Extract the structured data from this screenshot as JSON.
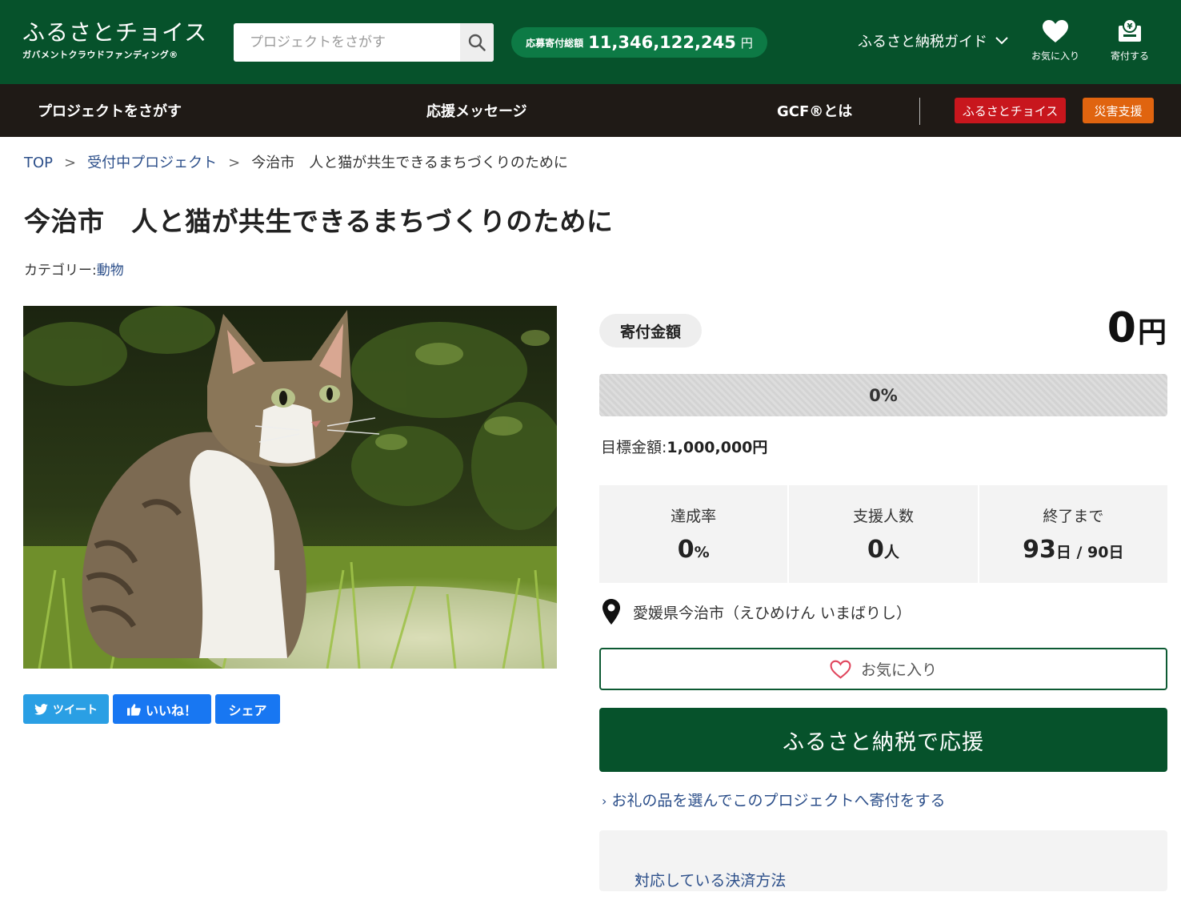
{
  "header": {
    "logo_main": "ふるさとチョイス",
    "logo_sub": "ガバメントクラウドファンディング®",
    "search_placeholder": "プロジェクトをさがす",
    "total_label": "応募寄付総額",
    "total_value": "11,346,122,245",
    "total_unit": "円",
    "guide_label": "ふるさと納税ガイド",
    "favorites_label": "お気に入り",
    "donate_label": "寄付する",
    "colors": {
      "header_bg": "#06522b",
      "pill_bg": "#0d7a45"
    }
  },
  "nav": {
    "items": [
      "プロジェクトをさがす",
      "応援メッセージ",
      "GCF®とは"
    ],
    "tag_choice": "ふるさとチョイス",
    "tag_disaster": "災害支援",
    "colors": {
      "nav_bg": "#1f1a16",
      "choice_tag": "#c8161d",
      "disaster_tag": "#e0640f"
    }
  },
  "breadcrumb": {
    "top": "TOP",
    "projects": "受付中プロジェクト",
    "current": "今治市　人と猫が共生できるまちづくりのために",
    "separator": ">"
  },
  "page": {
    "title": "今治市　人と猫が共生できるまちづくりのために",
    "category_label": "カテゴリー:",
    "category_value": "動物"
  },
  "social": {
    "tweet": "ツイート",
    "like": "いいね！",
    "share": "シェア"
  },
  "donation": {
    "amount_label": "寄付金額",
    "amount_value": "0",
    "amount_unit": "円",
    "progress_fraction": 0,
    "progress_text": "0%",
    "goal_label": "目標金額:",
    "goal_value": "1,000,000円",
    "stats": {
      "rate_label": "達成率",
      "rate_value": "0",
      "rate_unit": "%",
      "supporters_label": "支援人数",
      "supporters_value": "0",
      "supporters_unit": "人",
      "remaining_label": "終了まで",
      "remaining_value": "93",
      "remaining_unit": "日 / 90日"
    },
    "location": "愛媛県今治市（えひめけん いまばりし）",
    "favorite_button": "お気に入り",
    "donate_button": "ふるさと納税で応援",
    "gift_link": "お礼の品を選んでこのプロジェクトへ寄付をする",
    "payment_link": "対応している決済方法"
  }
}
